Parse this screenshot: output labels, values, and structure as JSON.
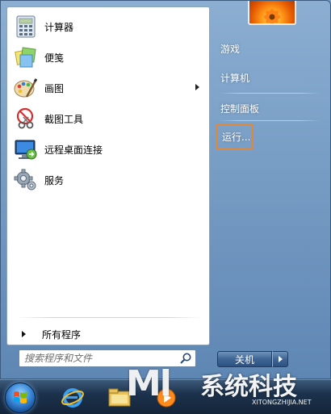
{
  "start_menu": {
    "programs": [
      {
        "label": "计算器",
        "icon": "calculator-icon"
      },
      {
        "label": "便笺",
        "icon": "sticky-notes-icon"
      },
      {
        "label": "画图",
        "icon": "paint-icon",
        "has_submenu": true
      },
      {
        "label": "截图工具",
        "icon": "snipping-tool-icon"
      },
      {
        "label": "远程桌面连接",
        "icon": "remote-desktop-icon"
      },
      {
        "label": "服务",
        "icon": "services-gear-icon"
      }
    ],
    "all_programs_label": "所有程序",
    "search_placeholder": "搜索程序和文件",
    "right_items": [
      {
        "label": "游戏"
      },
      {
        "label": "计算机"
      },
      {
        "label": "控制面板"
      },
      {
        "label": "运行...",
        "highlighted": true
      }
    ],
    "shutdown_label": "关机"
  },
  "taskbar": {
    "apps": [
      {
        "icon": "windows-start-orb-icon"
      },
      {
        "icon": "internet-explorer-icon"
      },
      {
        "icon": "file-explorer-folder-icon"
      },
      {
        "icon": "media-player-icon"
      }
    ]
  },
  "watermark": {
    "logo": "Ml",
    "name": "系统科技",
    "url": "XITONGZHIJIA.NET"
  },
  "colors": {
    "highlight_border": "#e0873a",
    "menu_glass": "#5f87b4",
    "taskbar": "#1c324d"
  }
}
